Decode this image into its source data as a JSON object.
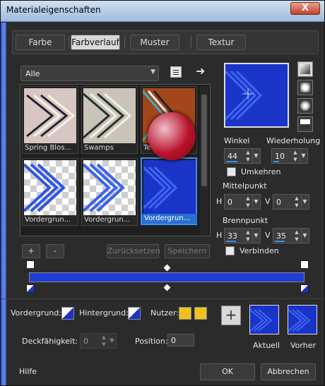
{
  "window": {
    "title": "Materialeigenschaften",
    "close": "X"
  },
  "tabs": [
    "Farbe",
    "Farbverlauf",
    "Muster",
    "Textur"
  ],
  "active_tab": "Farbverlauf",
  "category": {
    "value": "Alle"
  },
  "gallery": {
    "items": [
      {
        "label": "Spring Blos..."
      },
      {
        "label": "Swamps"
      },
      {
        "label": "Te..."
      },
      {
        "label": "Vordergrun..."
      },
      {
        "label": "Vordergrun..."
      },
      {
        "label": "Vordergrun..."
      }
    ],
    "selected_index": 5
  },
  "gallery_buttons": {
    "add": "+",
    "remove": "-",
    "reset": "Zurücksetzen",
    "save": "Speichern"
  },
  "angle": {
    "label": "Winkel",
    "value": "44"
  },
  "repeat": {
    "label": "Wiederholung",
    "value": "10"
  },
  "invert": {
    "label": "Umkehren",
    "checked": false
  },
  "center": {
    "label": "Mittelpunkt",
    "h_label": "H",
    "h": "0",
    "v_label": "V",
    "v": "0"
  },
  "focus": {
    "label": "Brennpunkt",
    "h_label": "H",
    "h": "33",
    "v_label": "V",
    "v": "35"
  },
  "link": {
    "label": "Verbinden",
    "checked": false
  },
  "colors": {
    "foreground_label": "Vordergrund:",
    "background_label": "Hintergrund:",
    "user_label": "Nutzer:",
    "gradient": "#1e3ed6",
    "swatch_blue": "#1a34c8",
    "swatch_yellow": "#f2c21b"
  },
  "opacity": {
    "label": "Deckfähigkeit:",
    "value": "0"
  },
  "position": {
    "label": "Position:",
    "value": "0"
  },
  "current": {
    "label": "Aktuell"
  },
  "previous": {
    "label": "Vorher"
  },
  "footer": {
    "help": "Hilfe",
    "ok": "OK",
    "cancel": "Abbrechen"
  }
}
